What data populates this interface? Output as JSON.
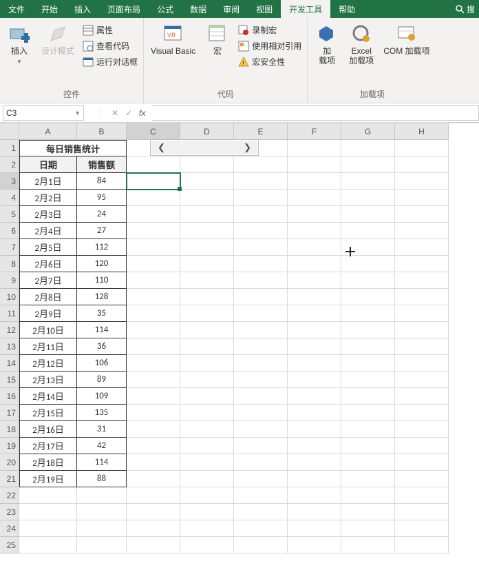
{
  "tabs": [
    "文件",
    "开始",
    "插入",
    "页面布局",
    "公式",
    "数据",
    "审阅",
    "视图",
    "开发工具",
    "帮助"
  ],
  "active_tab": 8,
  "search_hint": "搜",
  "ribbon": {
    "groups": {
      "controls": {
        "label": "控件",
        "insert": "插入",
        "design_mode": "设计模式",
        "properties": "属性",
        "view_code": "查看代码",
        "run_dialog": "运行对话框"
      },
      "code": {
        "label": "代码",
        "visual_basic": "Visual Basic",
        "macro": "宏",
        "record_macro": "录制宏",
        "relative_ref": "使用相对引用",
        "macro_security": "宏安全性"
      },
      "addins": {
        "label": "加载项",
        "addins": "加\n载项",
        "excel_addins": "Excel\n加载项",
        "com_addins": "COM 加载项"
      }
    }
  },
  "namebox": "C3",
  "columns": [
    "A",
    "B",
    "C",
    "D",
    "E",
    "F",
    "G",
    "H"
  ],
  "title": "每日销售统计",
  "headers": {
    "date": "日期",
    "sales": "销售额"
  },
  "rows": [
    {
      "date": "2月1日",
      "sales": 84
    },
    {
      "date": "2月2日",
      "sales": 95
    },
    {
      "date": "2月3日",
      "sales": 24
    },
    {
      "date": "2月4日",
      "sales": 27
    },
    {
      "date": "2月5日",
      "sales": 112
    },
    {
      "date": "2月6日",
      "sales": 120
    },
    {
      "date": "2月7日",
      "sales": 110
    },
    {
      "date": "2月8日",
      "sales": 128
    },
    {
      "date": "2月9日",
      "sales": 35
    },
    {
      "date": "2月10日",
      "sales": 114
    },
    {
      "date": "2月11日",
      "sales": 36
    },
    {
      "date": "2月12日",
      "sales": 106
    },
    {
      "date": "2月13日",
      "sales": 89
    },
    {
      "date": "2月14日",
      "sales": 109
    },
    {
      "date": "2月15日",
      "sales": 135
    },
    {
      "date": "2月16日",
      "sales": 31
    },
    {
      "date": "2月17日",
      "sales": 42
    },
    {
      "date": "2月18日",
      "sales": 114
    },
    {
      "date": "2月19日",
      "sales": 88
    }
  ],
  "empty_rows_after": 4,
  "selected_cell": "C3"
}
